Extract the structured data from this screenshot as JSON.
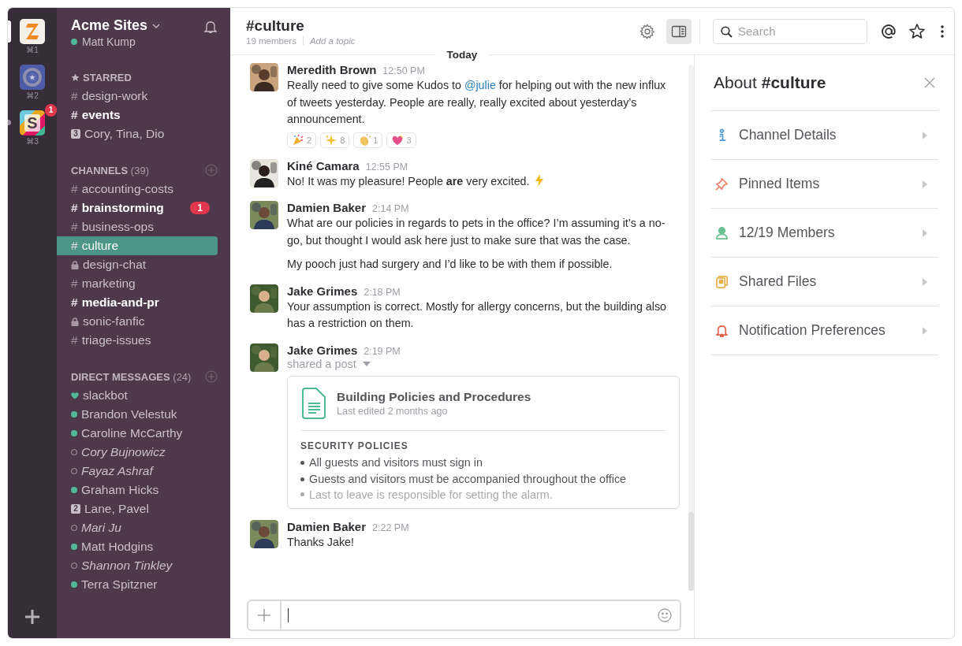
{
  "teams": [
    {
      "kind": "letter-logo",
      "shortcut": "⌘1",
      "selected": true,
      "unread": false
    },
    {
      "kind": "star-logo",
      "shortcut": "⌘2",
      "selected": false,
      "unread": false
    },
    {
      "kind": "tile-logo",
      "letter": "S",
      "shortcut": "⌘3",
      "selected": false,
      "unread": true,
      "badge": "1"
    }
  ],
  "workspace": {
    "name": "Acme Sites",
    "user": "Matt Kump"
  },
  "starred": {
    "label": "STARRED",
    "items": [
      {
        "kind": "public",
        "prefix": "#",
        "name": "design-work",
        "unread": false
      },
      {
        "kind": "public",
        "prefix": "#",
        "name": "events",
        "unread": true
      },
      {
        "kind": "group",
        "count": "3",
        "name": "Cory, Tina, Dio",
        "unread": false
      }
    ]
  },
  "channels": {
    "label": "CHANNELS",
    "count": "(39)",
    "items": [
      {
        "kind": "public",
        "prefix": "#",
        "name": "accounting-costs",
        "unread": false,
        "selected": false
      },
      {
        "kind": "public",
        "prefix": "#",
        "name": "brainstorming",
        "unread": true,
        "selected": false,
        "badge": "1"
      },
      {
        "kind": "public",
        "prefix": "#",
        "name": "business-ops",
        "unread": false,
        "selected": false
      },
      {
        "kind": "public",
        "prefix": "#",
        "name": "culture",
        "unread": false,
        "selected": true
      },
      {
        "kind": "private",
        "name": "design-chat",
        "unread": false,
        "selected": false
      },
      {
        "kind": "public",
        "prefix": "#",
        "name": "marketing",
        "unread": false,
        "selected": false
      },
      {
        "kind": "public",
        "prefix": "#",
        "name": "media-and-pr",
        "unread": true,
        "selected": false
      },
      {
        "kind": "private",
        "name": "sonic-fanfic",
        "unread": false,
        "selected": false
      },
      {
        "kind": "public",
        "prefix": "#",
        "name": "triage-issues",
        "unread": false,
        "selected": false
      }
    ]
  },
  "direct_messages": {
    "label": "DIRECT MESSAGES",
    "count": "(24)",
    "items": [
      {
        "kind": "bot",
        "name": "slackbot"
      },
      {
        "kind": "user",
        "name": "Brandon Velestuk",
        "online": true
      },
      {
        "kind": "user",
        "name": "Caroline McCarthy",
        "online": true
      },
      {
        "kind": "user",
        "name": "Cory Bujnowicz",
        "online": false
      },
      {
        "kind": "user",
        "name": "Fayaz Ashraf",
        "online": false
      },
      {
        "kind": "user",
        "name": "Graham Hicks",
        "online": true
      },
      {
        "kind": "group",
        "count": "2",
        "name": "Lane, Pavel"
      },
      {
        "kind": "user",
        "name": "Mari Ju",
        "online": false
      },
      {
        "kind": "user",
        "name": "Matt Hodgins",
        "online": true
      },
      {
        "kind": "user",
        "name": "Shannon Tinkley",
        "online": false
      },
      {
        "kind": "user",
        "name": "Terra Spitzner",
        "online": true
      }
    ]
  },
  "channel_header": {
    "title": "#culture",
    "members": "19 members",
    "topic": "Add a topic"
  },
  "search": {
    "placeholder": "Search"
  },
  "date_divider": "Today",
  "messages": [
    {
      "kind": "text",
      "author": "Meredith Brown",
      "time": "12:50 PM",
      "paragraphs": [
        [
          {
            "text": "Really need to give some Kudos to "
          },
          {
            "kind": "mention",
            "text": "@julie"
          },
          {
            "text": " for helping out with the new influx of tweets yesterday. People are really, really excited about yesterday’s announcement."
          }
        ]
      ],
      "reactions": [
        {
          "kind": "party",
          "count": "2"
        },
        {
          "kind": "sparkles",
          "count": "8"
        },
        {
          "kind": "clap",
          "count": "1"
        },
        {
          "kind": "heart",
          "count": "3"
        }
      ]
    },
    {
      "kind": "text",
      "author": "Kiné Camara",
      "time": "12:55 PM",
      "paragraphs": [
        [
          {
            "text": "No! It was my pleasure! People **are** very excited."
          },
          {
            "kind": "lightning"
          }
        ]
      ]
    },
    {
      "kind": "text",
      "author": "Damien Baker",
      "time": "2:14 PM",
      "paragraphs": [
        [
          {
            "text": "What are our policies in regards to pets in the office? I’m assuming it’s a no-go, but thought I would ask here just to make sure that was the case."
          }
        ],
        [
          {
            "text": "My pooch just had surgery and I’d like to be with them if possible."
          }
        ]
      ]
    },
    {
      "kind": "text",
      "author": "Jake Grimes",
      "time": "2:18 PM",
      "paragraphs": [
        [
          {
            "text": "Your assumption is correct. Mostly for allergy concerns, but the building also has a restriction on them."
          }
        ]
      ]
    },
    {
      "kind": "post",
      "author": "Jake Grimes",
      "time": "2:19 PM",
      "action": "shared a post",
      "post": {
        "title": "Building Policies and Procedures",
        "subtitle": "Last edited 2 months ago",
        "section": "SECURITY POLICIES",
        "bullets": [
          {
            "text": "All guests and visitors must sign in",
            "faded": false
          },
          {
            "text": "Guests and visitors must be accompanied throughout the office",
            "faded": false
          },
          {
            "text": "Last to leave is responsible for setting the alarm.",
            "faded": true
          }
        ]
      }
    },
    {
      "kind": "text",
      "author": "Damien Baker",
      "time": "2:22 PM",
      "paragraphs": [
        [
          {
            "text": "Thanks Jake!"
          }
        ]
      ]
    }
  ],
  "details": {
    "title": "About **#culture**",
    "items": [
      {
        "kind": "info",
        "label": "Channel Details",
        "color": "#4a9ad9"
      },
      {
        "kind": "pin",
        "label": "Pinned Items",
        "color": "#e8806a"
      },
      {
        "kind": "person",
        "label": "12/19 Members",
        "color": "#6cc08f"
      },
      {
        "kind": "files",
        "label": "Shared Files",
        "color": "#e8b04a"
      },
      {
        "kind": "bell",
        "label": "Notification Preferences",
        "color": "#e0634a"
      }
    ]
  }
}
